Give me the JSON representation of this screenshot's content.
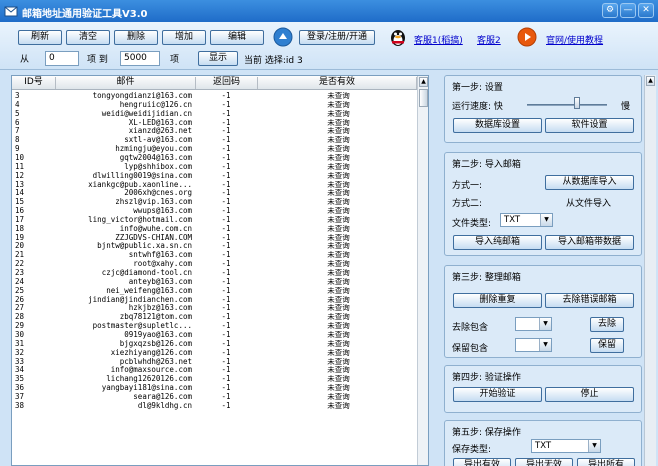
{
  "window": {
    "title": "邮箱地址通用验证工具V3.0",
    "minimize": "—",
    "close": "✕"
  },
  "toolbar": {
    "refresh": "刷新",
    "clear": "清空",
    "delete": "删除",
    "add": "增加",
    "edit": "编辑",
    "from_label": "从",
    "from_value": "0",
    "to_label": "项 到",
    "to_value": "5000",
    "item_label": "项",
    "show": "显示",
    "current": "当前 选择:id 3",
    "login": "登录/注册/开通",
    "support1": "客服1(稻搞)",
    "support2": "客服2",
    "website": "官网/使用教程"
  },
  "list": {
    "headers": [
      "ID号",
      "邮件",
      "返回码",
      "是否有效"
    ],
    "rows": [
      [
        "3",
        "tongyongdianzi@163.com",
        "-1",
        "未查询"
      ],
      [
        "4",
        "hengruiic@126.cn",
        "-1",
        "未查询"
      ],
      [
        "5",
        "weidi@weidijidian.cn",
        "-1",
        "未查询"
      ],
      [
        "6",
        "XL-LED@163.com",
        "-1",
        "未查询"
      ],
      [
        "7",
        "xianzd@263.net",
        "-1",
        "未查询"
      ],
      [
        "8",
        "sxtl-av@163.com",
        "-1",
        "未查询"
      ],
      [
        "9",
        "hzmingju@eyou.com",
        "-1",
        "未查询"
      ],
      [
        "10",
        "gqtw2004@163.com",
        "-1",
        "未查询"
      ],
      [
        "11",
        "lyp@shhibox.com",
        "-1",
        "未查询"
      ],
      [
        "12",
        "dlwilling0019@sina.com",
        "-1",
        "未查询"
      ],
      [
        "13",
        "xiankgc@pub.xaonline...",
        "-1",
        "未查询"
      ],
      [
        "14",
        "2006xh@cnes.org",
        "-1",
        "未查询"
      ],
      [
        "15",
        "zhszl@vip.163.com",
        "-1",
        "未查询"
      ],
      [
        "16",
        "wwups@163.com",
        "-1",
        "未查询"
      ],
      [
        "17",
        "ling_victor@hotmail.com",
        "-1",
        "未查询"
      ],
      [
        "18",
        "info@wuhe.com.cn",
        "-1",
        "未查询"
      ],
      [
        "19",
        "ZZJGDVS-CHIAN.COM",
        "-1",
        "未查询"
      ],
      [
        "20",
        "bjntw@public.xa.sn.cn",
        "-1",
        "未查询"
      ],
      [
        "21",
        "sntwhf@163.com",
        "-1",
        "未查询"
      ],
      [
        "22",
        "root@xahy.com",
        "-1",
        "未查询"
      ],
      [
        "23",
        "czjc@diamond-tool.cn",
        "-1",
        "未查询"
      ],
      [
        "24",
        "anteyb@163.com",
        "-1",
        "未查询"
      ],
      [
        "25",
        "nei_weifeng@163.com",
        "-1",
        "未查询"
      ],
      [
        "26",
        "jindian@jindianchen.com",
        "-1",
        "未查询"
      ],
      [
        "27",
        "hzkjbz@163.com",
        "-1",
        "未查询"
      ],
      [
        "28",
        "zbq78121@tom.com",
        "-1",
        "未查询"
      ],
      [
        "29",
        "postmaster@supletlc...",
        "-1",
        "未查询"
      ],
      [
        "30",
        "0919yao@163.com",
        "-1",
        "未查询"
      ],
      [
        "31",
        "bjgxqzsb@126.com",
        "-1",
        "未查询"
      ],
      [
        "32",
        "xiezhiyang@126.com",
        "-1",
        "未查询"
      ],
      [
        "33",
        "pcblwhdh@263.net",
        "-1",
        "未查询"
      ],
      [
        "34",
        "info@maxsource.com",
        "-1",
        "未查询"
      ],
      [
        "35",
        "lichang12620126.com",
        "-1",
        "未查询"
      ],
      [
        "36",
        "yangbayi181@sina.com",
        "-1",
        "未查询"
      ],
      [
        "37",
        "seara@126.com",
        "-1",
        "未查询"
      ],
      [
        "38",
        "dl@9kldhg.cn",
        "-1",
        "未查询"
      ]
    ]
  },
  "step1": {
    "title": "第一步: 设置",
    "speed_label": "运行速度: 快",
    "speed_slow": "慢",
    "speed_level": 0.62,
    "db_settings": "数据库设置",
    "software_settings": "软件设置"
  },
  "step2": {
    "title": "第二步: 导入邮箱",
    "method1": "方式一:",
    "from_db": "从数据库导入",
    "method2": "方式二:",
    "from_file": "从文件导入",
    "file_type_label": "文件类型:",
    "file_type": "TXT",
    "import_plain": "导入纯邮箱",
    "import_with_data": "导入邮箱带数据"
  },
  "step3": {
    "title": "第三步: 整理邮箱",
    "dedupe": "删除重复",
    "remove_invalid": "去除错误邮箱",
    "remove_contains": "去除包含",
    "remove_btn": "去除",
    "keep_contains": "保留包含",
    "keep_btn": "保留"
  },
  "step4": {
    "title": "第四步: 验证操作",
    "start": "开始验证",
    "stop": "停止"
  },
  "step5": {
    "title": "第五步: 保存操作",
    "save_type_label": "保存类型:",
    "save_type": "TXT",
    "btn1": "导出有效",
    "btn2": "导出无效",
    "btn3": "导出所有"
  }
}
